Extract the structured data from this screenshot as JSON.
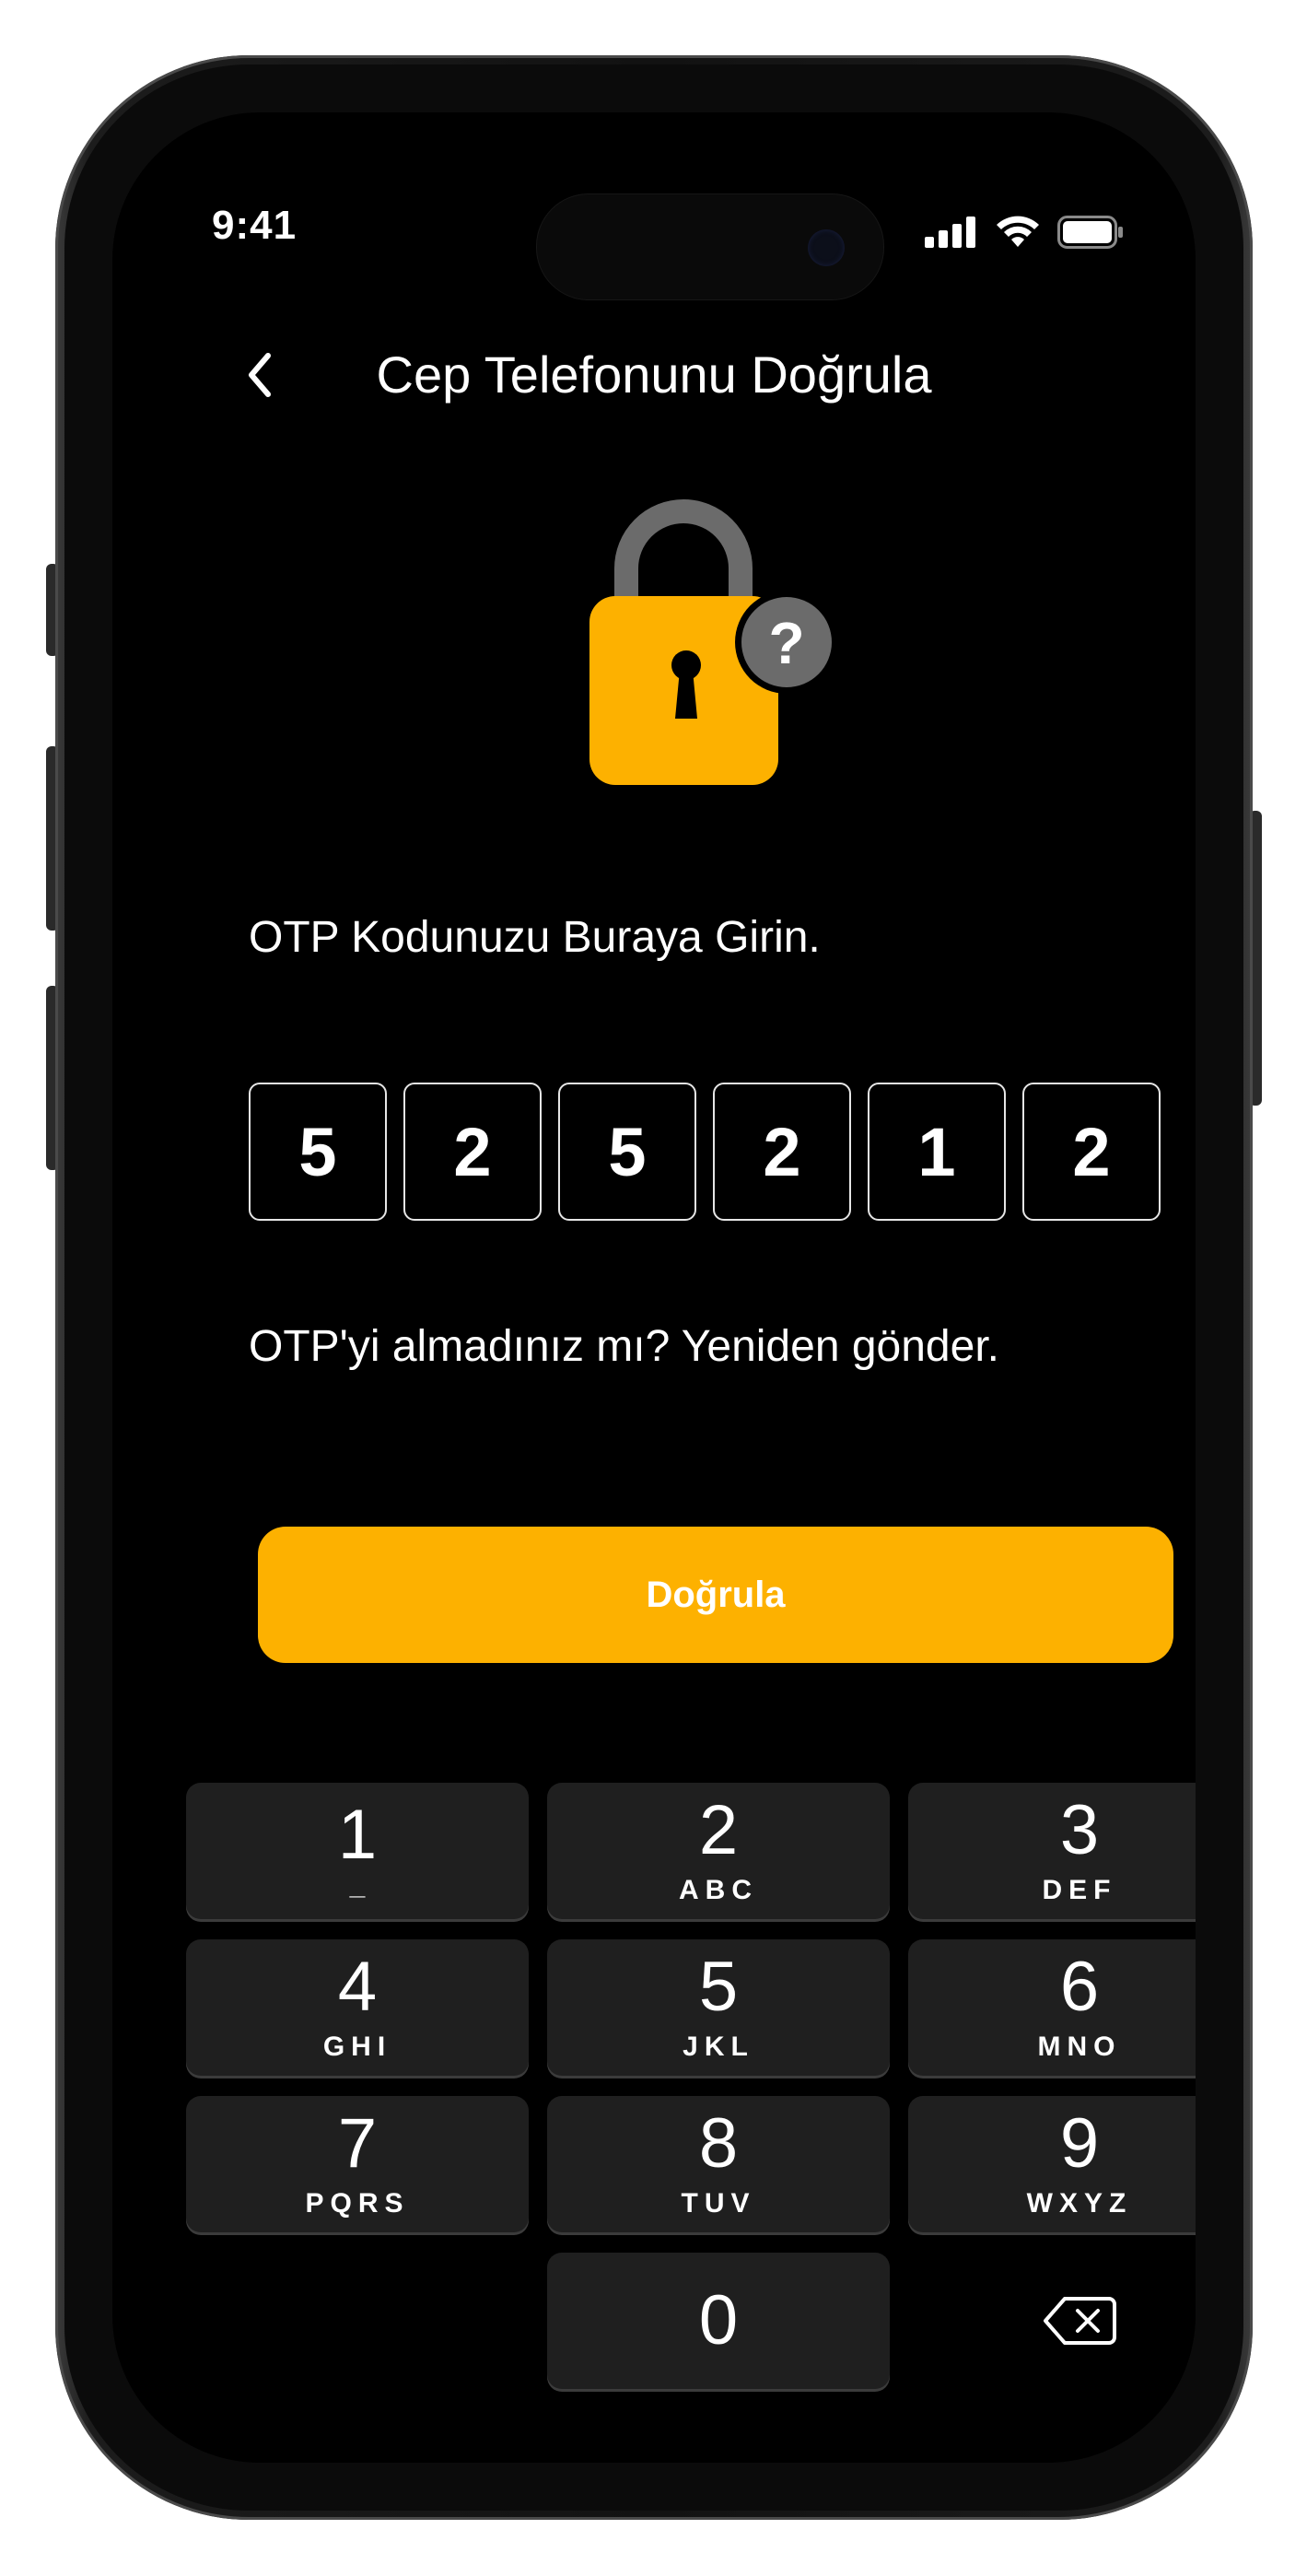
{
  "status_bar": {
    "time": "9:41"
  },
  "header": {
    "title": "Cep Telefonunu Doğrula"
  },
  "prompt": "OTP Kodunuzu Buraya Girin.",
  "otp": {
    "digits": [
      "5",
      "2",
      "5",
      "2",
      "1",
      "2"
    ]
  },
  "resend_text": "OTP'yi almadınız mı? Yeniden gönder.",
  "verify_button": {
    "label": "Doğrula"
  },
  "keypad": {
    "keys": [
      {
        "digit": "1",
        "letters": "_"
      },
      {
        "digit": "2",
        "letters": "ABC"
      },
      {
        "digit": "3",
        "letters": "DEF"
      },
      {
        "digit": "4",
        "letters": "GHI"
      },
      {
        "digit": "5",
        "letters": "JKL"
      },
      {
        "digit": "6",
        "letters": "MNO"
      },
      {
        "digit": "7",
        "letters": "PQRS"
      },
      {
        "digit": "8",
        "letters": "TUV"
      },
      {
        "digit": "9",
        "letters": "WXYZ"
      },
      {
        "digit": "0",
        "letters": ""
      }
    ],
    "backspace_icon": "backspace-icon"
  },
  "colors": {
    "accent": "#fdb100",
    "lock_shackle": "#6b6b6b",
    "key_background": "#1f1f1f",
    "screen_background": "#000000"
  },
  "icons": [
    "back-chevron-icon",
    "lock-icon",
    "question-badge-icon",
    "cellular-signal-icon",
    "wifi-icon",
    "battery-icon",
    "backspace-icon"
  ]
}
